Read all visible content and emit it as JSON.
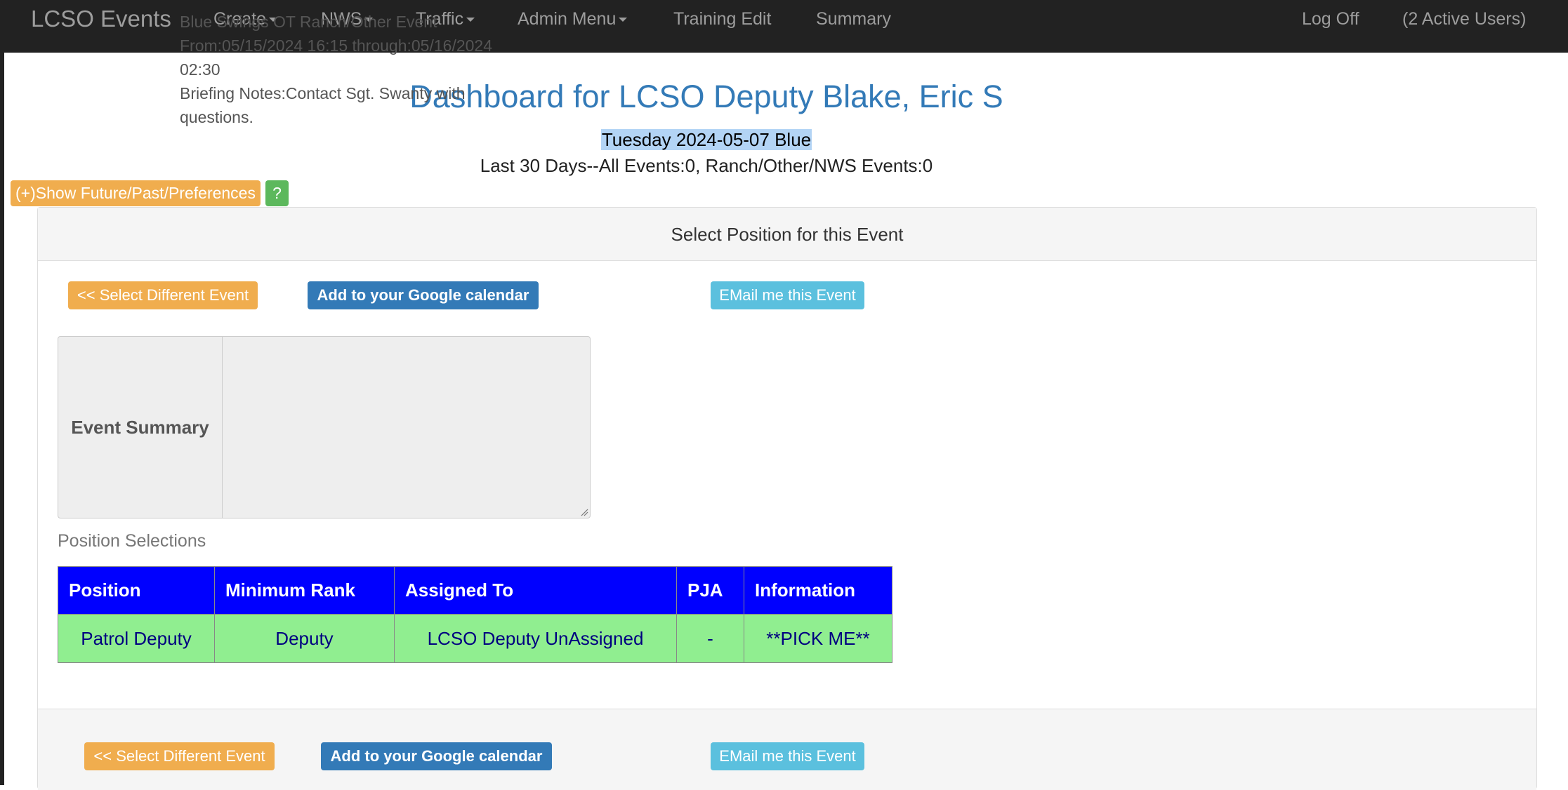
{
  "navbar": {
    "brand": "LCSO Events",
    "menus": [
      "Create",
      "NWS",
      "Traffic",
      "Admin Menu"
    ],
    "links": [
      "Training Edit",
      "Summary"
    ],
    "right": {
      "log_off": "Log Off",
      "active_users": "(2 Active Users)"
    }
  },
  "header": {
    "title": "Dashboard for LCSO Deputy Blake, Eric S",
    "date_line": "Tuesday 2024-05-07 Blue",
    "stats": "Last 30 Days--All Events:0, Ranch/Other/NWS Events:0",
    "toggle_button": "(+)Show Future/Past/Preferences",
    "help_button": "?"
  },
  "panel": {
    "heading": "Select Position for this Event",
    "buttons": {
      "select_different": "<< Select Different Event",
      "google_calendar": "Add to your Google calendar",
      "email": "EMail me this Event"
    },
    "summary": {
      "label": "Event Summary",
      "lines": [
        "Blue Swings OT Ranch/Other Event",
        "From:05/15/2024 16:15 through:05/16/2024 02:30",
        "Briefing Notes:Contact Sgt. Swanty with questions."
      ]
    },
    "positions": {
      "label": "Position Selections",
      "headers": [
        "Position",
        "Minimum Rank",
        "Assigned To",
        "PJA",
        "Information"
      ],
      "rows": [
        [
          "Patrol Deputy",
          "Deputy",
          "LCSO Deputy UnAssigned",
          "-",
          "**PICK ME**"
        ]
      ]
    }
  },
  "colors": {
    "navbar_bg": "#222222",
    "title": "#337ab7",
    "warning": "#f0ad4e",
    "success": "#5cb85c",
    "primary": "#337ab7",
    "info": "#5bc0de",
    "table_header": "#0000ff",
    "table_row": "#90ee90"
  }
}
